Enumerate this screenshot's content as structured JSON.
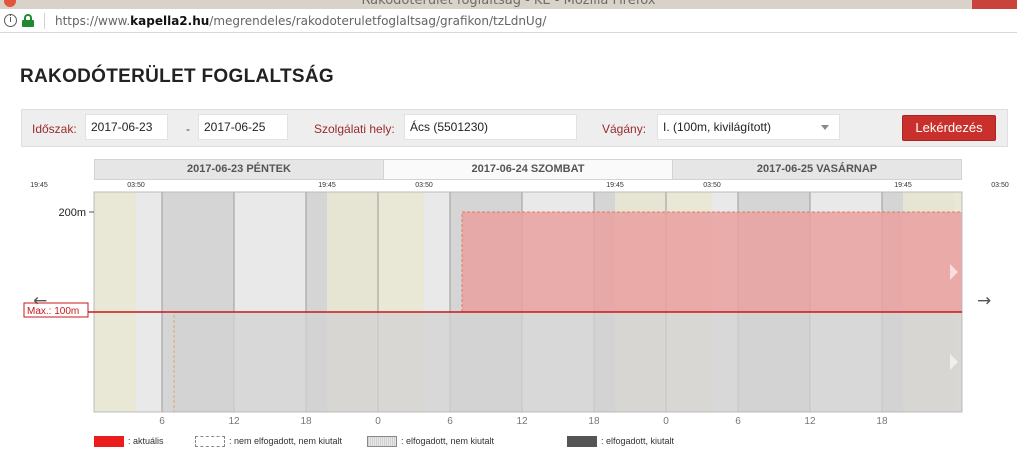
{
  "browser": {
    "window_title": "Rakodóterület foglaltság - KE - Mozilla Firefox",
    "url_prefix": "https://www.",
    "url_domain": "kapella2.hu",
    "url_path": "/megrendeles/rakodoteruletfoglaltsag/grafikon/tzLdnUg/"
  },
  "page": {
    "title": "RAKODÓTERÜLET FOGLALTSÁG"
  },
  "filter": {
    "period_label": "Időszak:",
    "date_from": "2017-06-23",
    "dash": "-",
    "date_to": "2017-06-25",
    "location_label": "Szolgálati hely:",
    "location_value": "Ács (5501230)",
    "track_label": "Vágány:",
    "track_value": "I. (100m, kivilágított)",
    "query_button": "Lekérdezés"
  },
  "chart": {
    "day_headers": [
      "2017-06-23 PÉNTEK",
      "2017-06-24 SZOMBAT",
      "2017-06-25 VASÁRNAP"
    ],
    "active_day": 1,
    "top_time_labels": [
      {
        "t": 19.75,
        "label": "19:45"
      },
      {
        "t": 27.833,
        "label": "03:50"
      },
      {
        "t": 43.75,
        "label": "19:45"
      },
      {
        "t": 51.833,
        "label": "03:50"
      },
      {
        "t": 67.75,
        "label": "19:45"
      },
      {
        "t": 75.833,
        "label": "03:50"
      },
      {
        "t": 91.75,
        "label": "19:45"
      },
      {
        "t": 99.833,
        "label": "03:50"
      }
    ],
    "x_ticks": [
      {
        "t": 30,
        "label": "6"
      },
      {
        "t": 36,
        "label": "12"
      },
      {
        "t": 42,
        "label": "18"
      },
      {
        "t": 48,
        "label": "0"
      },
      {
        "t": 54,
        "label": "6"
      },
      {
        "t": 60,
        "label": "12"
      },
      {
        "t": 66,
        "label": "18"
      },
      {
        "t": 72,
        "label": "0"
      },
      {
        "t": 78,
        "label": "6"
      },
      {
        "t": 84,
        "label": "12"
      },
      {
        "t": 90,
        "label": "18"
      }
    ],
    "y_label": "200m",
    "y_value": 200,
    "max_label": "Max.: 100m",
    "max_value": 100,
    "colors": {
      "night": "#e9e6d2",
      "bg_light": "#e9e9e9",
      "bg_dark": "#d5d5d5",
      "red_fill": "#eaa0a0",
      "red_line": "#c8181b",
      "grid": "#9b9b9b"
    }
  },
  "chart_data": {
    "type": "bar",
    "title": "",
    "x_unit": "hour (from 2017-06-22 00:00)",
    "xlim": [
      24.333,
      96.667
    ],
    "ylim": [
      0,
      220
    ],
    "y_ticks": [
      200
    ],
    "max_line": 100,
    "occupancies": [
      {
        "kind": "nem elfogadott, nem kiutalt",
        "start": 31.0,
        "end": 96.667,
        "length": 100,
        "lane": "lower"
      },
      {
        "kind": "nem elfogadott, nem kiutalt",
        "start": 55.0,
        "end": 96.667,
        "length": 200,
        "lane": "upper"
      }
    ],
    "legend": [
      ": aktuális",
      ": nem elfogadott, nem kiutalt",
      ": elfogadott, nem kiutalt",
      ": elfogadott, kiutalt"
    ]
  }
}
